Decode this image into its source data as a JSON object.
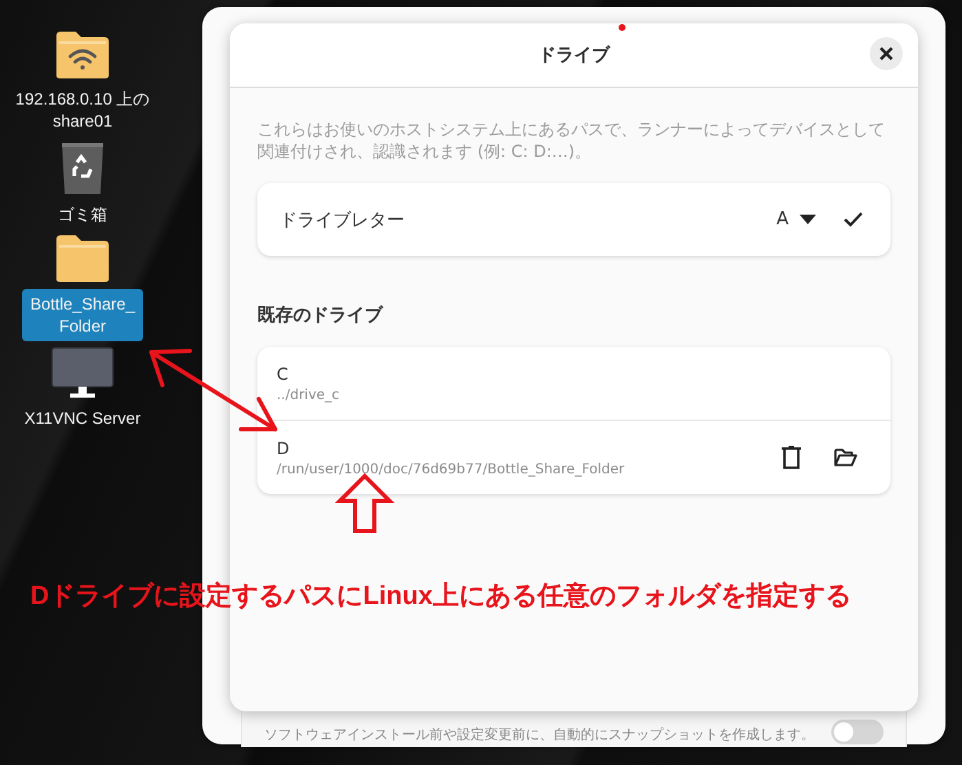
{
  "desktop": {
    "icons": [
      {
        "kind": "network-folder",
        "lines": [
          "192.168.0.10 上の",
          "share01"
        ],
        "selected": false
      },
      {
        "kind": "trash",
        "lines": [
          "ゴミ箱"
        ],
        "selected": false
      },
      {
        "kind": "folder",
        "lines": [
          "Bottle_Share_",
          "Folder"
        ],
        "selected": true
      },
      {
        "kind": "monitor",
        "lines": [
          "X11VNC Server"
        ],
        "selected": false
      }
    ]
  },
  "background_window": {
    "setting": {
      "text": "ソフトウェアインストール前や設定変更前に、自動的にスナップショットを作成します。",
      "on": false
    }
  },
  "dialog": {
    "title": "ドライブ",
    "description": "これらはお使いのホストシステム上にあるパスで、ランナーによってデバイスとして関連付けされ、認識されます (例: C: D:…)。",
    "drive_letter": {
      "label": "ドライブレター",
      "value": "A"
    },
    "section_title": "既存のドライブ",
    "drives": [
      {
        "letter": "C",
        "path": "../drive_c",
        "removable": false
      },
      {
        "letter": "D",
        "path": "/run/user/1000/doc/76d69b77/Bottle_Share_Folder",
        "removable": true
      }
    ]
  },
  "annotation": {
    "caption": "Dドライブに設定するパスにLinux上にある任意のフォルダを指定する"
  }
}
